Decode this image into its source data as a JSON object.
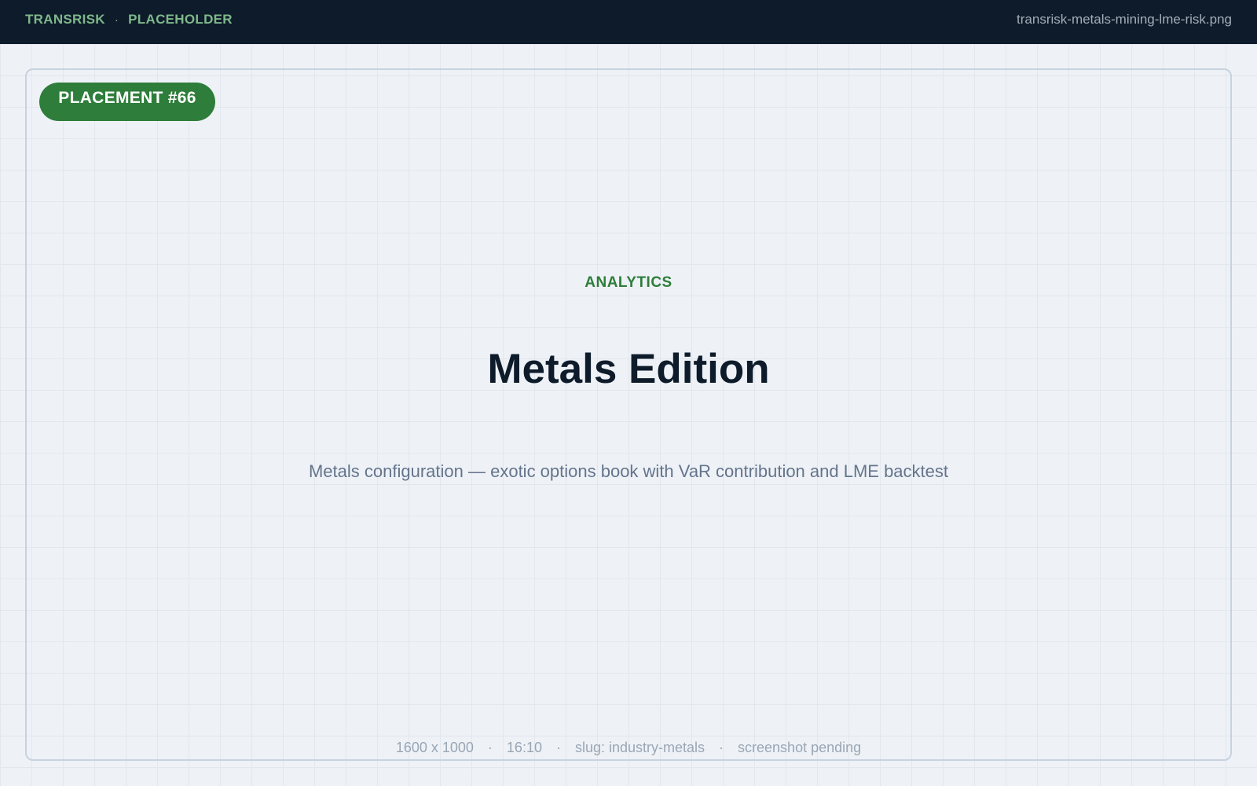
{
  "header": {
    "brand": "TRANSRISK",
    "separator": "·",
    "section": "PLACEHOLDER",
    "filename": "transrisk-metals-mining-lme-risk.png"
  },
  "badge": {
    "label": "PLACEMENT #66"
  },
  "main": {
    "eyebrow": "ANALYTICS",
    "title": "Metals Edition",
    "subtitle": "Metals configuration — exotic options book with VaR contribution and LME backtest"
  },
  "footer": {
    "dimensions": "1600 x 1000",
    "aspect": "16:10",
    "slug": "slug: industry-metals",
    "status": "screenshot pending",
    "separator": "·"
  },
  "colors": {
    "header_bg": "#0d1b2a",
    "accent_green": "#2e7d3a",
    "brand_green": "#7fb88a",
    "title_text": "#0d1b2a",
    "muted_text": "#64748b",
    "page_bg": "#eef2f7"
  }
}
